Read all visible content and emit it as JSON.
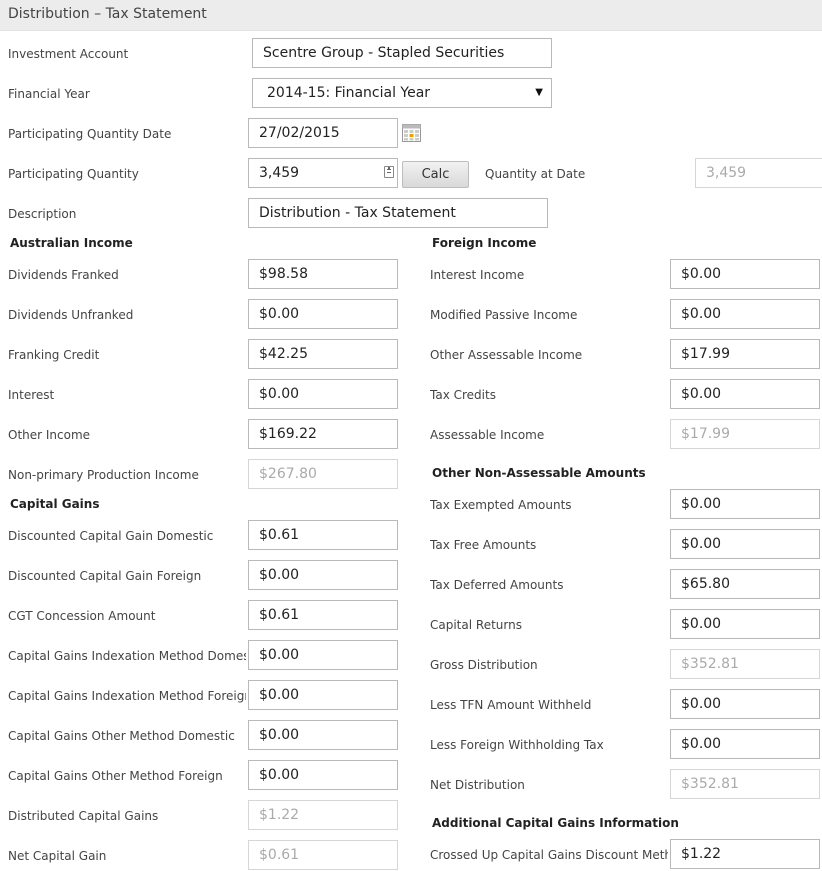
{
  "title": "Distribution – Tax Statement",
  "top": {
    "investment_account": {
      "label": "Investment Account",
      "value": "Scentre Group - Stapled Securities"
    },
    "financial_year": {
      "label": "Financial Year",
      "value": "2014-15: Financial Year"
    },
    "participating_quantity_date": {
      "label": "Participating Quantity Date",
      "value": "27/02/2015"
    },
    "participating_quantity": {
      "label": "Participating Quantity",
      "value": "3,459"
    },
    "calc_label": "Calc",
    "quantity_at_date": {
      "label": "Quantity at Date",
      "value": "3,459"
    },
    "description": {
      "label": "Description",
      "value": "Distribution - Tax Statement"
    }
  },
  "australian_income": {
    "heading": "Australian Income",
    "rows": [
      {
        "label": "Dividends Franked",
        "value": "$98.58"
      },
      {
        "label": "Dividends Unfranked",
        "value": "$0.00"
      },
      {
        "label": "Franking Credit",
        "value": "$42.25"
      },
      {
        "label": "Interest",
        "value": "$0.00"
      },
      {
        "label": "Other Income",
        "value": "$169.22"
      },
      {
        "label": "Non-primary Production Income",
        "value": "$267.80"
      }
    ]
  },
  "capital_gains": {
    "heading": "Capital Gains",
    "rows": [
      {
        "label": "Discounted Capital Gain Domestic",
        "value": "$0.61"
      },
      {
        "label": "Discounted Capital Gain Foreign",
        "value": "$0.00"
      },
      {
        "label": "CGT Concession Amount",
        "value": "$0.61"
      },
      {
        "label": "Capital Gains Indexation Method Domestic",
        "value": "$0.00"
      },
      {
        "label": "Capital Gains Indexation Method Foreign",
        "value": "$0.00"
      },
      {
        "label": "Capital Gains Other Method Domestic",
        "value": "$0.00"
      },
      {
        "label": "Capital Gains Other Method Foreign",
        "value": "$0.00"
      },
      {
        "label": "Distributed Capital Gains",
        "value": "$1.22"
      },
      {
        "label": "Net Capital Gain",
        "value": "$0.61"
      }
    ]
  },
  "foreign_income": {
    "heading": "Foreign Income",
    "rows": [
      {
        "label": "Interest Income",
        "value": "$0.00"
      },
      {
        "label": "Modified Passive Income",
        "value": "$0.00"
      },
      {
        "label": "Other Assessable Income",
        "value": "$17.99"
      },
      {
        "label": "Tax Credits",
        "value": "$0.00"
      },
      {
        "label": "Assessable Income",
        "value": "$17.99"
      }
    ]
  },
  "other_non_assessable": {
    "heading": "Other Non-Assessable Amounts",
    "rows": [
      {
        "label": "Tax Exempted Amounts",
        "value": "$0.00"
      },
      {
        "label": "Tax Free Amounts",
        "value": "$0.00"
      },
      {
        "label": "Tax Deferred Amounts",
        "value": "$65.80"
      },
      {
        "label": "Capital Returns",
        "value": "$0.00"
      },
      {
        "label": "Gross Distribution",
        "value": "$352.81"
      },
      {
        "label": "Less TFN Amount Withheld",
        "value": "$0.00"
      },
      {
        "label": "Less Foreign Withholding Tax",
        "value": "$0.00"
      },
      {
        "label": "Net Distribution",
        "value": "$352.81"
      }
    ]
  },
  "additional_cg": {
    "heading": "Additional Capital Gains Information",
    "rows": [
      {
        "label": "Crossed Up Capital Gains Discount Method",
        "value": "$1.22"
      }
    ]
  },
  "colors": {
    "titlebar_bg": "#ececec",
    "readonly_text": "#aaaaaa",
    "border": "#b9b9b9"
  },
  "icons": [
    "calendar-icon",
    "stepper-icon",
    "dropdown-caret-icon"
  ]
}
